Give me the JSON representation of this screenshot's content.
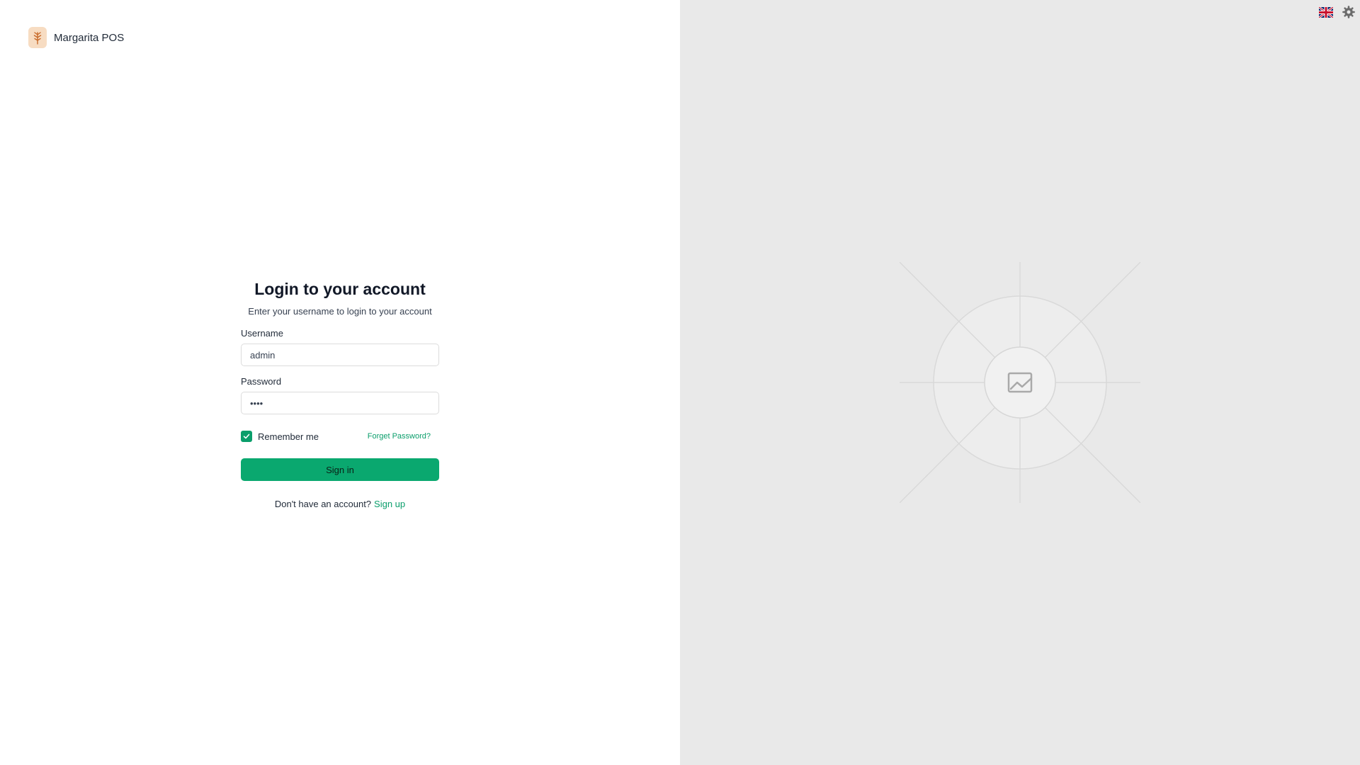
{
  "app": {
    "name": "Margarita POS"
  },
  "login": {
    "title": "Login to your account",
    "subtitle": "Enter your username to login to your account",
    "username_label": "Username",
    "username_value": "admin",
    "password_label": "Password",
    "password_value": "••••",
    "remember_label": "Remember me",
    "remember_checked": true,
    "forgot_label": "Forget Password?",
    "signin_label": "Sign in",
    "no_account_text": "Don't have an account?",
    "signup_label": "Sign up"
  },
  "topbar": {
    "language_icon": "uk-flag-icon",
    "settings_icon": "gear-icon"
  },
  "colors": {
    "accent": "#0aa86f",
    "right_panel_bg": "#e9e9e9"
  }
}
